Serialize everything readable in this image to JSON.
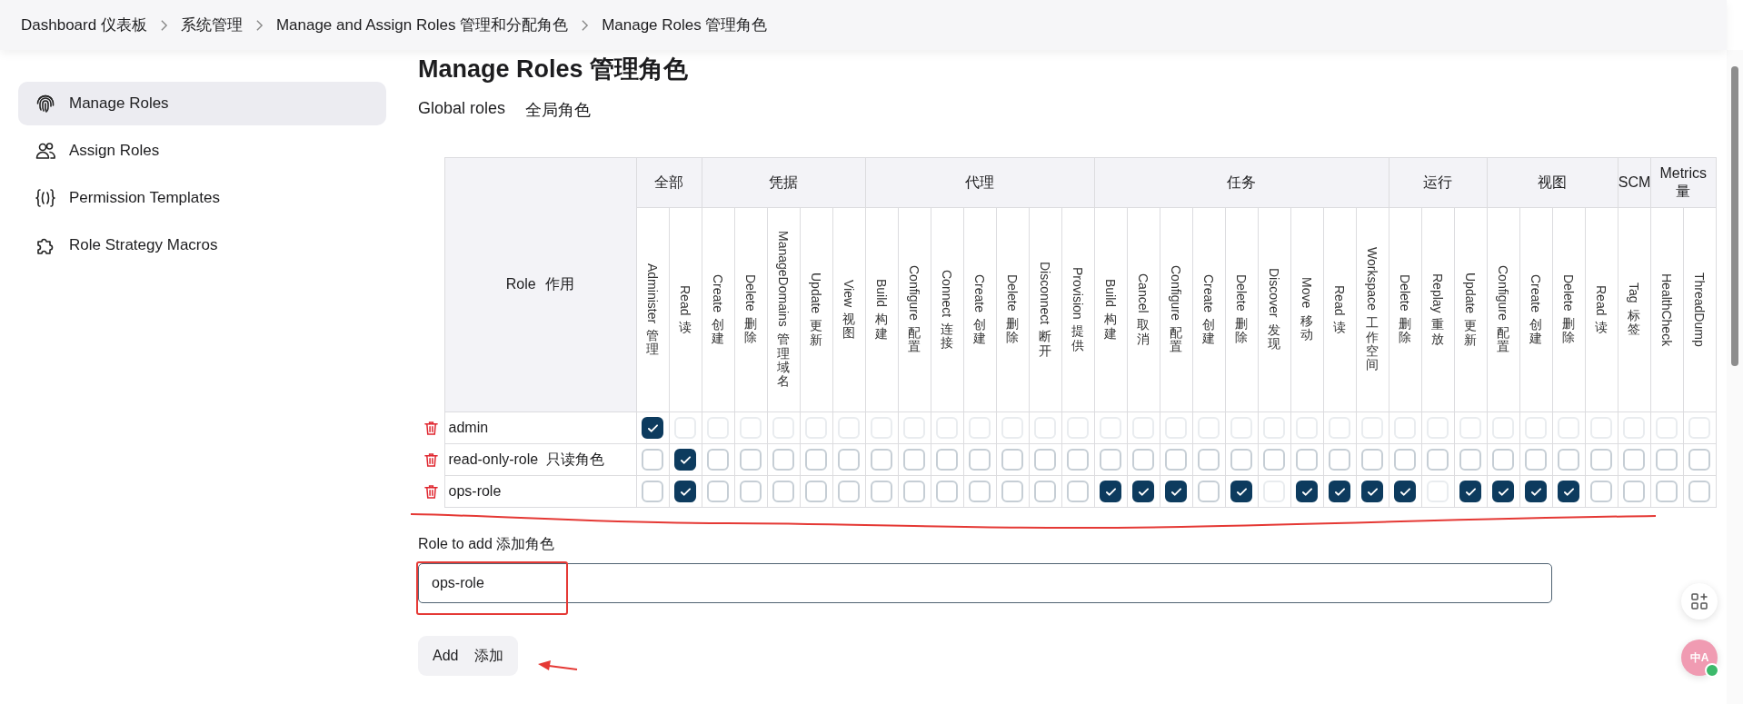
{
  "breadcrumb": [
    {
      "label": "Dashboard 仪表板"
    },
    {
      "label": "系统管理"
    },
    {
      "label": "Manage and Assign Roles 管理和分配角色"
    },
    {
      "label": "Manage Roles 管理角色"
    }
  ],
  "sidebar": {
    "items": [
      {
        "label": "Manage Roles",
        "kind": "fingerprint",
        "selected": true
      },
      {
        "label": "Assign Roles",
        "kind": "people",
        "selected": false
      },
      {
        "label": "Permission Templates",
        "kind": "braces",
        "selected": false
      },
      {
        "label": "Role Strategy Macros",
        "kind": "puzzle",
        "selected": false
      }
    ]
  },
  "heading": "Manage Roles 管理角色",
  "section_title": {
    "label": "Global roles",
    "translation": "全局角色"
  },
  "table": {
    "role_header": "Role 作用",
    "groups": [
      {
        "label": "全部",
        "permissions": [
          {
            "en": "Administer",
            "zh": "管理"
          },
          {
            "en": "Read",
            "zh": "读"
          }
        ]
      },
      {
        "label": "凭据",
        "permissions": [
          {
            "en": "Create",
            "zh": "创建"
          },
          {
            "en": "Delete",
            "zh": "删除"
          },
          {
            "en": "ManageDomains",
            "zh": "管理域名"
          },
          {
            "en": "Update",
            "zh": "更新"
          },
          {
            "en": "View",
            "zh": "视图"
          }
        ]
      },
      {
        "label": "代理",
        "permissions": [
          {
            "en": "Build",
            "zh": "构建"
          },
          {
            "en": "Configure",
            "zh": "配置"
          },
          {
            "en": "Connect",
            "zh": "连接"
          },
          {
            "en": "Create",
            "zh": "创建"
          },
          {
            "en": "Delete",
            "zh": "删除"
          },
          {
            "en": "Disconnect",
            "zh": "断开"
          },
          {
            "en": "Provision",
            "zh": "提供"
          }
        ]
      },
      {
        "label": "任务",
        "permissions": [
          {
            "en": "Build",
            "zh": "构建"
          },
          {
            "en": "Cancel",
            "zh": "取消"
          },
          {
            "en": "Configure",
            "zh": "配置"
          },
          {
            "en": "Create",
            "zh": "创建"
          },
          {
            "en": "Delete",
            "zh": "删除"
          },
          {
            "en": "Discover",
            "zh": "发现"
          },
          {
            "en": "Move",
            "zh": "移动"
          },
          {
            "en": "Read",
            "zh": "读"
          },
          {
            "en": "Workspace",
            "zh": "工作空间"
          }
        ]
      },
      {
        "label": "运行",
        "permissions": [
          {
            "en": "Delete",
            "zh": "删除"
          },
          {
            "en": "Replay",
            "zh": "重放"
          },
          {
            "en": "Update",
            "zh": "更新"
          }
        ]
      },
      {
        "label": "视图",
        "permissions": [
          {
            "en": "Configure",
            "zh": "配置"
          },
          {
            "en": "Create",
            "zh": "创建"
          },
          {
            "en": "Delete",
            "zh": "删除"
          },
          {
            "en": "Read",
            "zh": "读"
          }
        ]
      },
      {
        "label": "SCM",
        "permissions": [
          {
            "en": "Tag",
            "zh": "标签"
          }
        ]
      },
      {
        "label": "Metrics 量",
        "permissions": [
          {
            "en": "HealthCheck"
          },
          {
            "en": "ThreadDump"
          }
        ]
      }
    ],
    "rows": [
      {
        "name": "admin",
        "permissions": [
          {
            "checked": true,
            "disabled": false
          },
          {
            "checked": false,
            "disabled": true
          },
          {
            "checked": false,
            "disabled": true
          },
          {
            "checked": false,
            "disabled": true
          },
          {
            "checked": false,
            "disabled": true
          },
          {
            "checked": false,
            "disabled": true
          },
          {
            "checked": false,
            "disabled": true
          },
          {
            "checked": false,
            "disabled": true
          },
          {
            "checked": false,
            "disabled": true
          },
          {
            "checked": false,
            "disabled": true
          },
          {
            "checked": false,
            "disabled": true
          },
          {
            "checked": false,
            "disabled": true
          },
          {
            "checked": false,
            "disabled": true
          },
          {
            "checked": false,
            "disabled": true
          },
          {
            "checked": false,
            "disabled": true
          },
          {
            "checked": false,
            "disabled": true
          },
          {
            "checked": false,
            "disabled": true
          },
          {
            "checked": false,
            "disabled": true
          },
          {
            "checked": false,
            "disabled": true
          },
          {
            "checked": false,
            "disabled": true
          },
          {
            "checked": false,
            "disabled": true
          },
          {
            "checked": false,
            "disabled": true
          },
          {
            "checked": false,
            "disabled": true
          },
          {
            "checked": false,
            "disabled": true
          },
          {
            "checked": false,
            "disabled": true
          },
          {
            "checked": false,
            "disabled": true
          },
          {
            "checked": false,
            "disabled": true
          },
          {
            "checked": false,
            "disabled": true
          },
          {
            "checked": false,
            "disabled": true
          },
          {
            "checked": false,
            "disabled": true
          },
          {
            "checked": false,
            "disabled": true
          },
          {
            "checked": false,
            "disabled": true
          },
          {
            "checked": false,
            "disabled": true
          }
        ]
      },
      {
        "name": "read-only-role 只读角色",
        "permissions": [
          {
            "checked": false,
            "disabled": false
          },
          {
            "checked": true,
            "disabled": false
          },
          {
            "checked": false,
            "disabled": false
          },
          {
            "checked": false,
            "disabled": false
          },
          {
            "checked": false,
            "disabled": false
          },
          {
            "checked": false,
            "disabled": false
          },
          {
            "checked": false,
            "disabled": false
          },
          {
            "checked": false,
            "disabled": false
          },
          {
            "checked": false,
            "disabled": false
          },
          {
            "checked": false,
            "disabled": false
          },
          {
            "checked": false,
            "disabled": false
          },
          {
            "checked": false,
            "disabled": false
          },
          {
            "checked": false,
            "disabled": false
          },
          {
            "checked": false,
            "disabled": false
          },
          {
            "checked": false,
            "disabled": false
          },
          {
            "checked": false,
            "disabled": false
          },
          {
            "checked": false,
            "disabled": false
          },
          {
            "checked": false,
            "disabled": false
          },
          {
            "checked": false,
            "disabled": false
          },
          {
            "checked": false,
            "disabled": false
          },
          {
            "checked": false,
            "disabled": false
          },
          {
            "checked": false,
            "disabled": false
          },
          {
            "checked": false,
            "disabled": false
          },
          {
            "checked": false,
            "disabled": false
          },
          {
            "checked": false,
            "disabled": false
          },
          {
            "checked": false,
            "disabled": false
          },
          {
            "checked": false,
            "disabled": false
          },
          {
            "checked": false,
            "disabled": false
          },
          {
            "checked": false,
            "disabled": false
          },
          {
            "checked": false,
            "disabled": false
          },
          {
            "checked": false,
            "disabled": false
          },
          {
            "checked": false,
            "disabled": false
          },
          {
            "checked": false,
            "disabled": false
          }
        ]
      },
      {
        "name": "ops-role",
        "permissions": [
          {
            "checked": false,
            "disabled": false
          },
          {
            "checked": true,
            "disabled": false
          },
          {
            "checked": false,
            "disabled": false
          },
          {
            "checked": false,
            "disabled": false
          },
          {
            "checked": false,
            "disabled": false
          },
          {
            "checked": false,
            "disabled": false
          },
          {
            "checked": false,
            "disabled": false
          },
          {
            "checked": false,
            "disabled": false
          },
          {
            "checked": false,
            "disabled": false
          },
          {
            "checked": false,
            "disabled": false
          },
          {
            "checked": false,
            "disabled": false
          },
          {
            "checked": false,
            "disabled": false
          },
          {
            "checked": false,
            "disabled": false
          },
          {
            "checked": false,
            "disabled": false
          },
          {
            "checked": true,
            "disabled": false
          },
          {
            "checked": true,
            "disabled": false
          },
          {
            "checked": true,
            "disabled": false
          },
          {
            "checked": false,
            "disabled": false
          },
          {
            "checked": true,
            "disabled": false
          },
          {
            "checked": false,
            "disabled": true
          },
          {
            "checked": true,
            "disabled": false
          },
          {
            "checked": true,
            "disabled": false
          },
          {
            "checked": true,
            "disabled": false
          },
          {
            "checked": true,
            "disabled": false
          },
          {
            "checked": false,
            "disabled": true
          },
          {
            "checked": true,
            "disabled": false
          },
          {
            "checked": true,
            "disabled": false
          },
          {
            "checked": true,
            "disabled": false
          },
          {
            "checked": true,
            "disabled": false
          },
          {
            "checked": false,
            "disabled": false
          },
          {
            "checked": false,
            "disabled": false
          },
          {
            "checked": false,
            "disabled": false
          },
          {
            "checked": false,
            "disabled": false
          }
        ]
      }
    ]
  },
  "role_to_add": {
    "label": "Role to add 添加角色",
    "value": "ops-role"
  },
  "add_button": {
    "label": "Add",
    "translation": "添加"
  },
  "floating": {
    "translate_label": "中A"
  },
  "annotations": [
    {
      "kind": "underline"
    },
    {
      "kind": "box"
    },
    {
      "kind": "arrow"
    }
  ]
}
